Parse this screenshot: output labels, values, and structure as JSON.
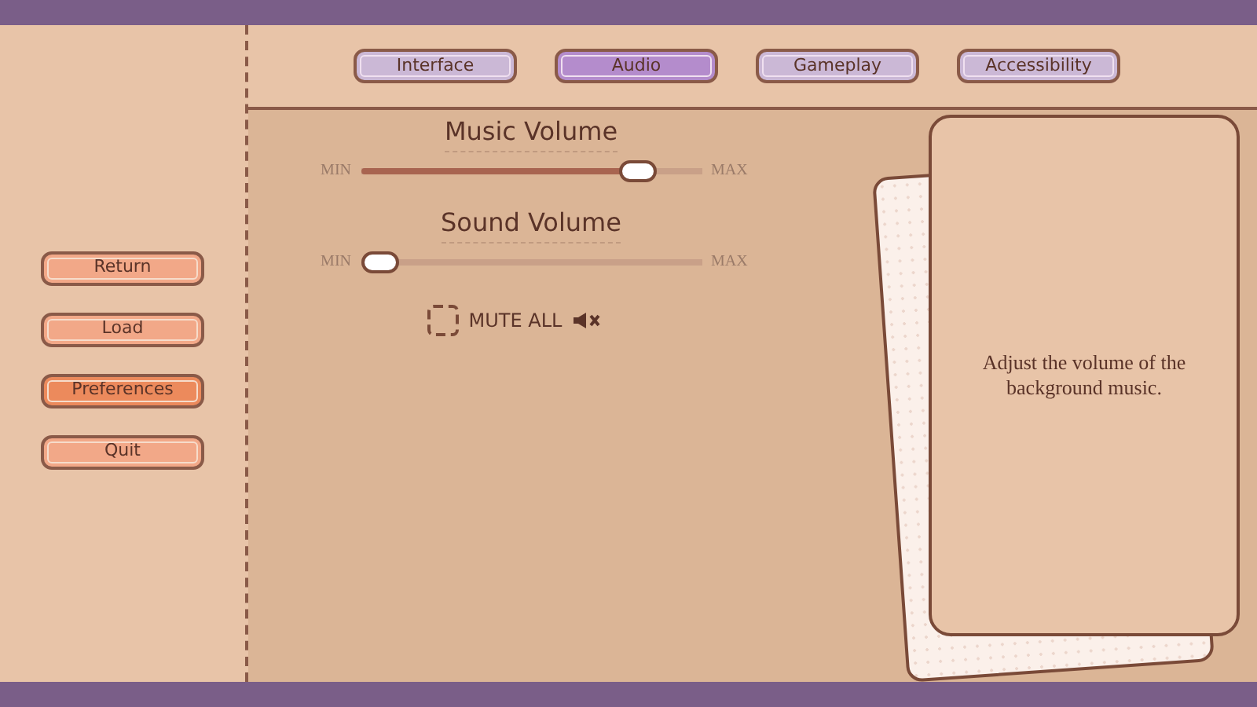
{
  "menu": [
    {
      "label": "Return",
      "selected": false
    },
    {
      "label": "Load",
      "selected": false
    },
    {
      "label": "Preferences",
      "selected": true
    },
    {
      "label": "Quit",
      "selected": false
    }
  ],
  "tabs": [
    {
      "label": "Interface",
      "selected": false
    },
    {
      "label": "Audio",
      "selected": true
    },
    {
      "label": "Gameplay",
      "selected": false
    },
    {
      "label": "Accessibility",
      "selected": false
    }
  ],
  "sliders": [
    {
      "title": "Music Volume",
      "min_label": "MIN",
      "max_label": "MAX",
      "level": 0.85
    },
    {
      "title": "Sound Volume",
      "min_label": "MIN",
      "max_label": "MAX",
      "level": 0
    }
  ],
  "mute": {
    "label": "MUTE ALL",
    "checked": false
  },
  "description": "Adjust the volume of the background music."
}
